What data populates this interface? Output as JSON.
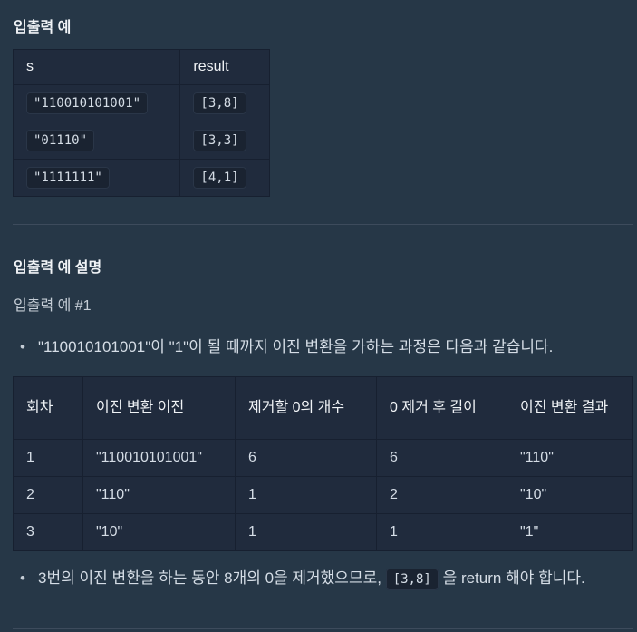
{
  "section1": {
    "title": "입출력 예",
    "headers": [
      "s",
      "result"
    ],
    "rows": [
      [
        "\"110010101001\"",
        "[3,8]"
      ],
      [
        "\"01110\"",
        "[3,3]"
      ],
      [
        "\"1111111\"",
        "[4,1]"
      ]
    ]
  },
  "section2": {
    "title": "입출력 예 설명",
    "subtitle": "입출력 예 #1",
    "bullet1": "\"110010101001\"이 \"1\"이 될 때까지 이진 변환을 가하는 과정은 다음과 같습니다.",
    "headers": [
      "회차",
      "이진 변환 이전",
      "제거할 0의 개수",
      "0 제거 후 길이",
      "이진 변환 결과"
    ],
    "rows": [
      [
        "1",
        "\"110010101001\"",
        "6",
        "6",
        "\"110\""
      ],
      [
        "2",
        "\"110\"",
        "1",
        "2",
        "\"10\""
      ],
      [
        "3",
        "\"10\"",
        "1",
        "1",
        "\"1\""
      ]
    ],
    "bullet2_pre": "3번의 이진 변환을 하는 동안 8개의 0을 제거했으므로,",
    "bullet2_code": "[3,8]",
    "bullet2_post": "을 return 해야 합니다."
  }
}
